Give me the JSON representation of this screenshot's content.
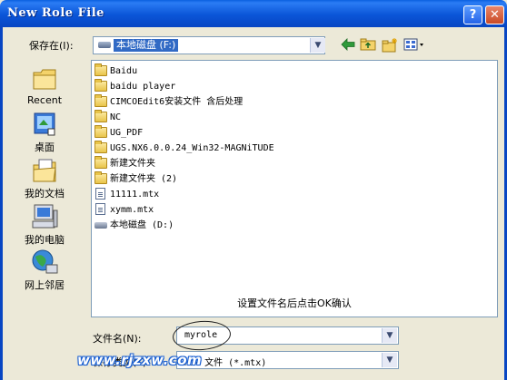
{
  "window": {
    "title": "New Role File",
    "help_label": "?",
    "close_label": "✕"
  },
  "lookin": {
    "label": "保存在(I):",
    "value": "本地磁盘 (F:)"
  },
  "toolbar": {
    "back_icon": "back-arrow-icon",
    "up_icon": "up-folder-icon",
    "new_folder_icon": "new-folder-icon",
    "views_icon": "views-menu-icon"
  },
  "places": [
    {
      "label": "Recent",
      "icon": "recent-clock-icon"
    },
    {
      "label": "桌面",
      "icon": "desktop-icon"
    },
    {
      "label": "我的文档",
      "icon": "my-documents-icon"
    },
    {
      "label": "我的电脑",
      "icon": "my-computer-icon"
    },
    {
      "label": "网上邻居",
      "icon": "network-places-icon"
    }
  ],
  "files": [
    {
      "name": "Baidu",
      "kind": "folder"
    },
    {
      "name": "baidu player",
      "kind": "folder"
    },
    {
      "name": "CIMCOEdit6安装文件 含后处理",
      "kind": "folder"
    },
    {
      "name": "NC",
      "kind": "folder"
    },
    {
      "name": "UG_PDF",
      "kind": "folder"
    },
    {
      "name": "UGS.NX6.0.0.24_Win32-MAGNiTUDE",
      "kind": "folder"
    },
    {
      "name": "新建文件夹",
      "kind": "folder"
    },
    {
      "name": "新建文件夹 (2)",
      "kind": "folder"
    },
    {
      "name": "11111.mtx",
      "kind": "file"
    },
    {
      "name": "xymm.mtx",
      "kind": "file"
    },
    {
      "name": "本地磁盘 (D:)",
      "kind": "drive"
    }
  ],
  "hint": "设置文件名后点击OK确认",
  "filename": {
    "label": "文件名(N):",
    "value": "myrole"
  },
  "filetype": {
    "label": "保存类型(T):",
    "value": "mtx 文件 (*.mtx)"
  },
  "watermark": "www.rjzxw.com",
  "colors": {
    "titlebar": "#0a55d8",
    "selection": "#316ac5",
    "dialog_bg": "#ece9d8"
  }
}
